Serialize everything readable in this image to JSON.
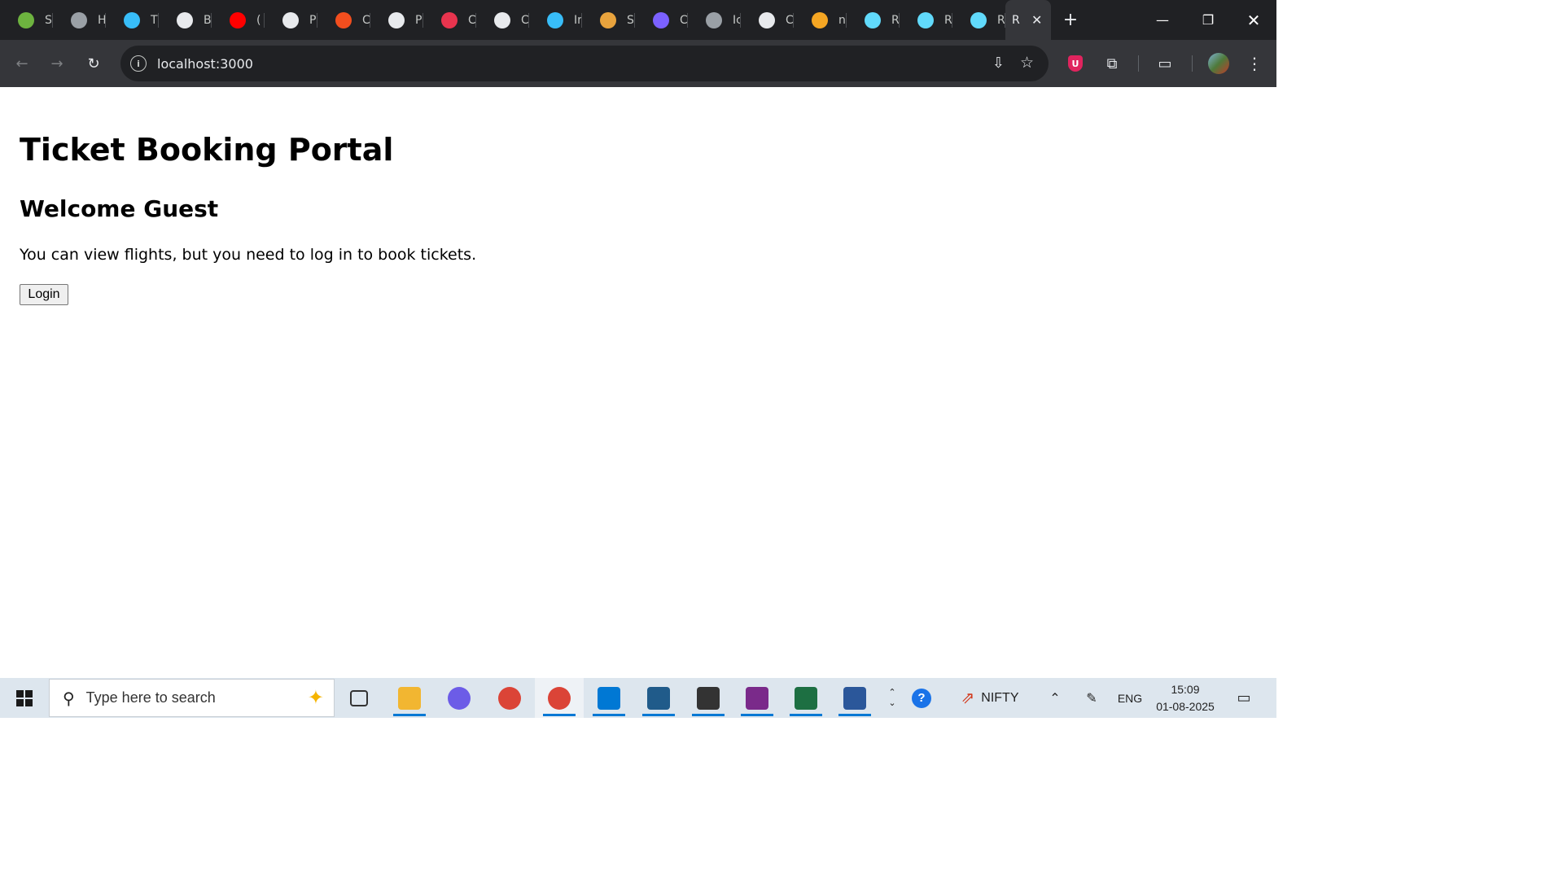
{
  "browser": {
    "tabs": [
      {
        "title": "S",
        "icon": "spring-icon",
        "color": "#6db33f"
      },
      {
        "title": "H",
        "icon": "globe-icon",
        "color": "#9aa0a6"
      },
      {
        "title": "T",
        "icon": "tailwind-icon",
        "color": "#38bdf8"
      },
      {
        "title": "B",
        "icon": "openai-icon",
        "color": "#e8eaed"
      },
      {
        "title": "(",
        "icon": "youtube-icon",
        "color": "#ff0000"
      },
      {
        "title": "P",
        "icon": "github-icon",
        "color": "#e8eaed"
      },
      {
        "title": "C",
        "icon": "figma-icon",
        "color": "#f24e1e"
      },
      {
        "title": "P",
        "icon": "github-icon",
        "color": "#e8eaed"
      },
      {
        "title": "C",
        "icon": "quora-icon",
        "color": "#e8344e"
      },
      {
        "title": "C",
        "icon": "openai-icon",
        "color": "#e8eaed"
      },
      {
        "title": "Ir",
        "icon": "tailwind-icon",
        "color": "#38bdf8"
      },
      {
        "title": "S",
        "icon": "colorful-icon",
        "color": "#e8a33d"
      },
      {
        "title": "C",
        "icon": "copilot-icon",
        "color": "#7b61ff"
      },
      {
        "title": "Ic",
        "icon": "globe-icon",
        "color": "#9aa0a6"
      },
      {
        "title": "C",
        "icon": "openai-icon",
        "color": "#e8eaed"
      },
      {
        "title": "n",
        "icon": "infinity-icon",
        "color": "#f5a623"
      },
      {
        "title": "R",
        "icon": "react-icon",
        "color": "#61dafb"
      },
      {
        "title": "R",
        "icon": "react-icon",
        "color": "#61dafb"
      },
      {
        "title": "R",
        "icon": "react-icon",
        "color": "#61dafb"
      }
    ],
    "active_tab": {
      "title": "R"
    },
    "url": "localhost:3000"
  },
  "page": {
    "title": "Ticket Booking Portal",
    "welcome": "Welcome Guest",
    "message": "You can view flights, but you need to log in to book tickets.",
    "login_button": "Login"
  },
  "taskbar": {
    "search_placeholder": "Type here to search",
    "apps": [
      {
        "name": "task-view-icon"
      },
      {
        "name": "file-explorer-icon",
        "color": "#f2b631"
      },
      {
        "name": "copilot-icon",
        "color": "#6c5ce7"
      },
      {
        "name": "chrome-icon",
        "color": "#db4437"
      },
      {
        "name": "chrome-profile-icon",
        "color": "#db4437"
      },
      {
        "name": "vscode-icon",
        "color": "#0078d4"
      },
      {
        "name": "mysql-workbench-icon",
        "color": "#205b8a"
      },
      {
        "name": "settings-icon",
        "color": "#333333"
      },
      {
        "name": "winrar-icon",
        "color": "#7a2a8a"
      },
      {
        "name": "excel-icon",
        "color": "#1d6f42"
      },
      {
        "name": "word-icon",
        "color": "#2b579a"
      }
    ],
    "nifty_label": "NIFTY",
    "language": "ENG",
    "time": "15:09",
    "date": "01-08-2025"
  }
}
